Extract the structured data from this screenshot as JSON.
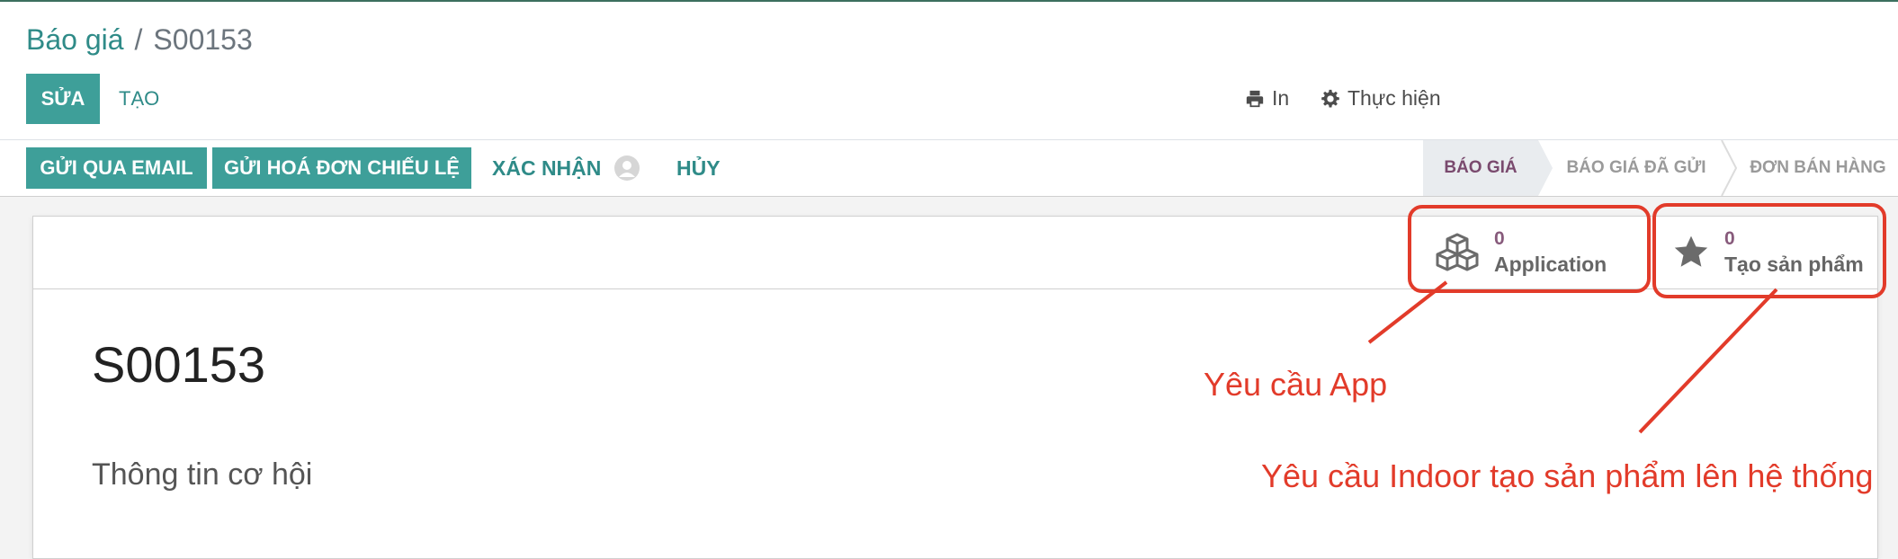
{
  "breadcrumb": {
    "parent": "Báo giá",
    "separator": "/",
    "current": "S00153"
  },
  "control_panel": {
    "edit_label": "SỬA",
    "create_label": "TẠO",
    "print_label": "In",
    "action_label": "Thực hiện"
  },
  "statusbar": {
    "buttons": {
      "send_email": "GỬI QUA EMAIL",
      "proforma": "GỬI HOÁ ĐƠN CHIẾU LỆ",
      "confirm": "XÁC NHẬN",
      "cancel": "HỦY"
    },
    "stages": [
      "BÁO GIÁ",
      "BÁO GIÁ ĐÃ GỬI",
      "ĐƠN BÁN HÀNG"
    ],
    "active_stage": "BÁO GIÁ"
  },
  "smart_buttons": [
    {
      "value": "0",
      "label": "Application",
      "icon": "cubes-icon"
    },
    {
      "value": "0",
      "label": "Tạo sản phẩm",
      "icon": "star-icon"
    }
  ],
  "form": {
    "record_name": "S00153",
    "section_title": "Thông tin cơ hội"
  },
  "annotations": {
    "app_note": "Yêu cầu App",
    "product_note": "Yêu cầu Indoor tạo sản phẩm lên hệ thống",
    "color": "#e23b2a"
  },
  "colors": {
    "primary": "#3e9f99",
    "link": "#2f8b88",
    "stat_value": "#875a7b",
    "active_stage": "#7a4a6e"
  }
}
